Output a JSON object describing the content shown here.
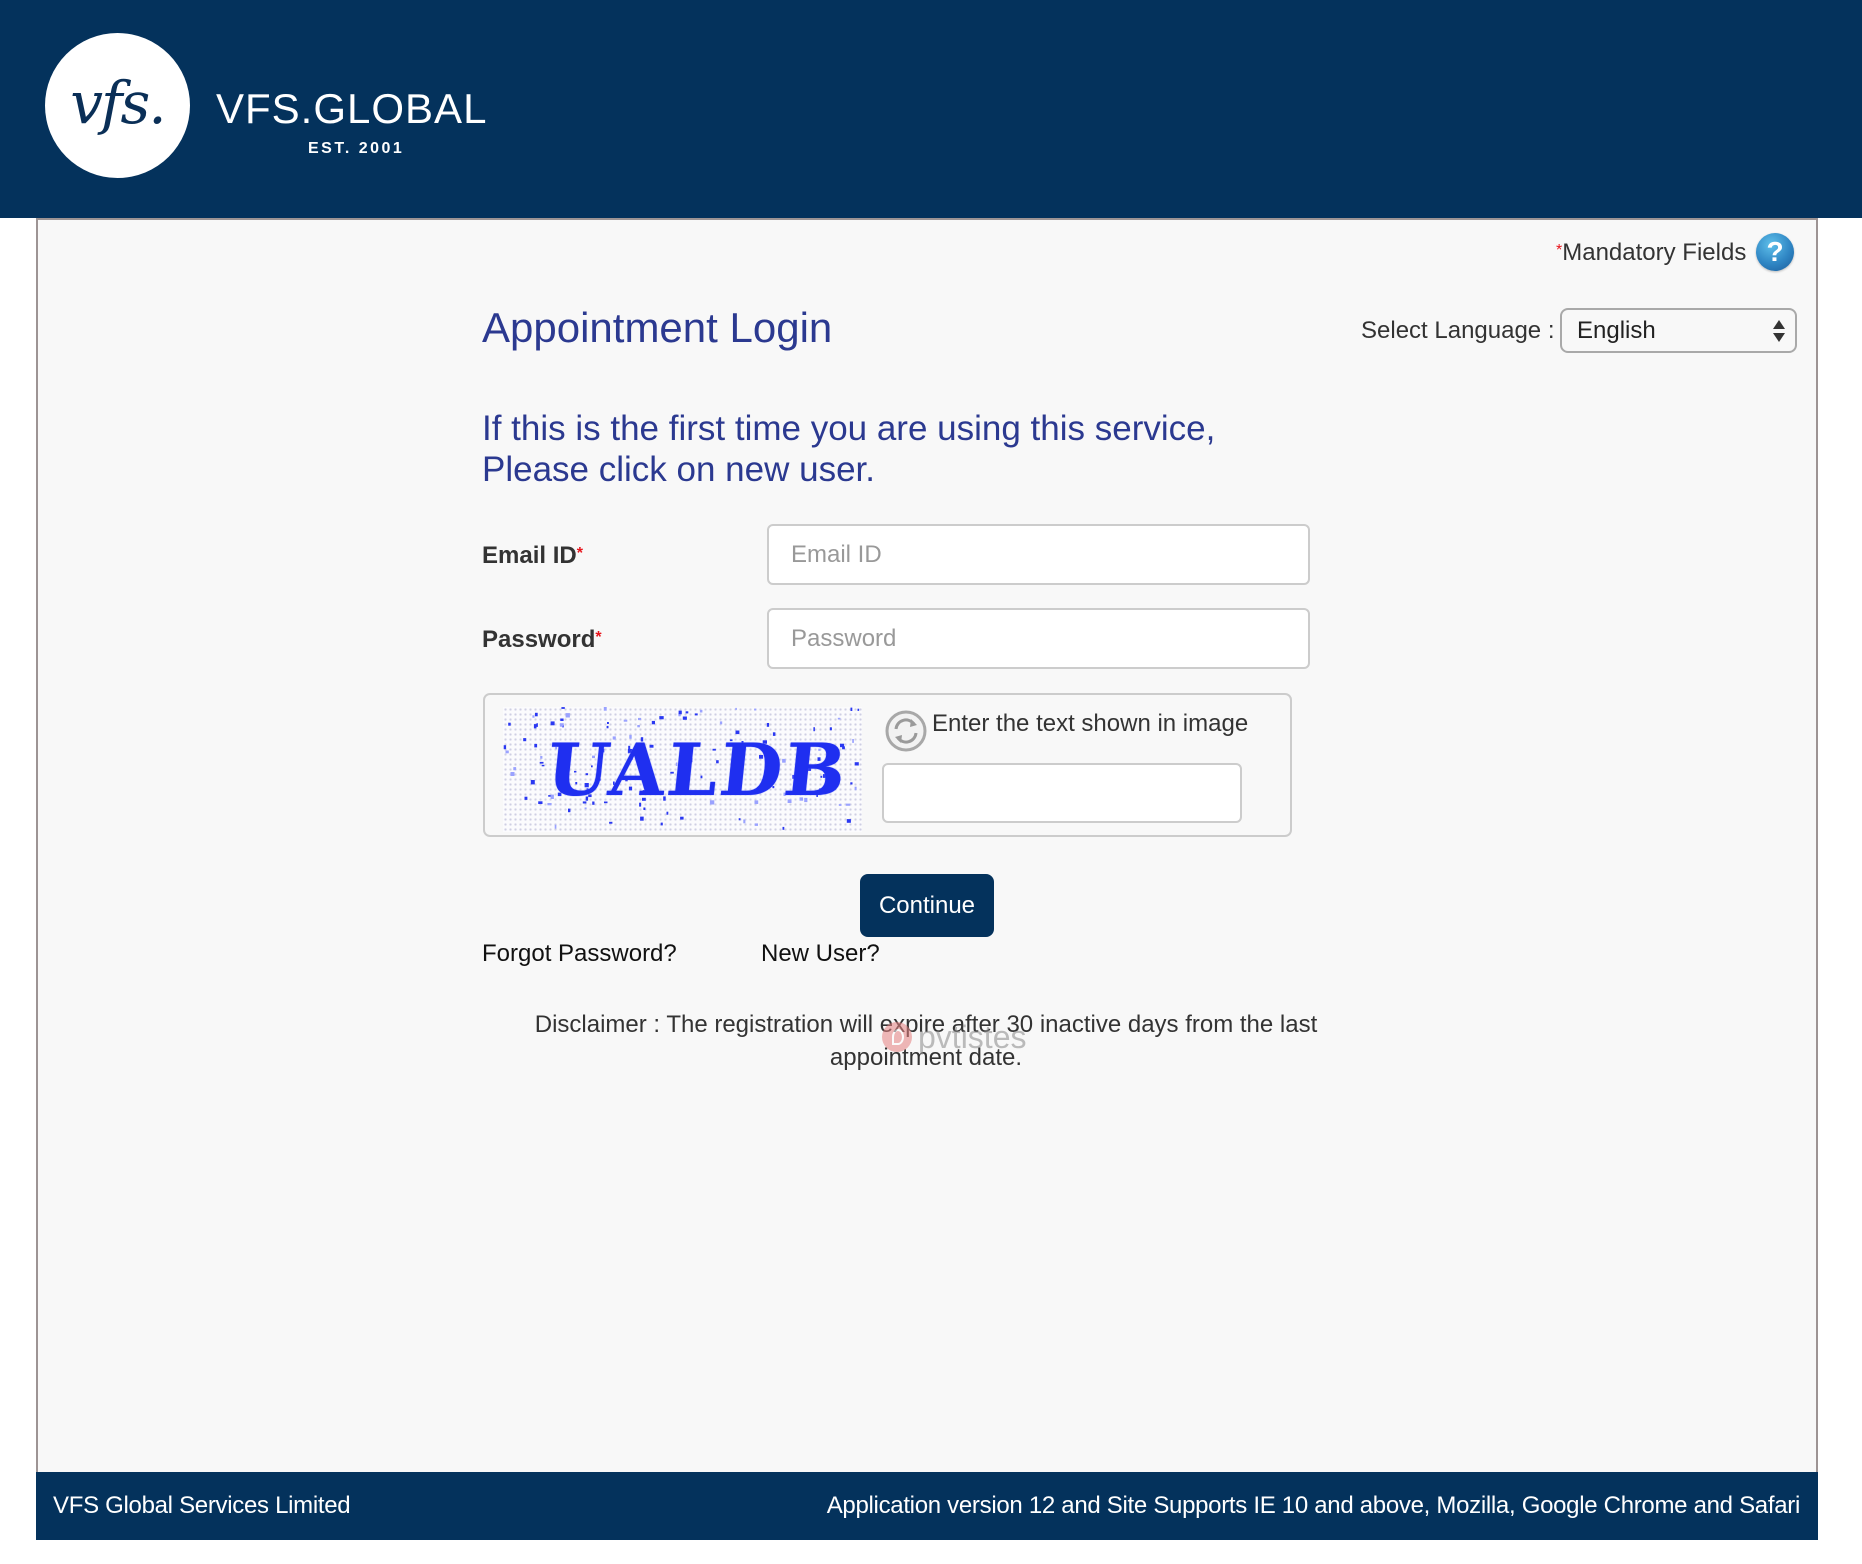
{
  "header": {
    "logo_mark": "vfs.",
    "brand_name": "VFS.GLOBAL",
    "established": "EST. 2001",
    "background_color": "#04325c"
  },
  "mandatory": {
    "star": "*",
    "label": "Mandatory Fields",
    "help_icon": "question-mark-icon",
    "help_glyph": "?"
  },
  "page": {
    "title": "Appointment Login",
    "intro_line1": "If this is the first time you are using this service,",
    "intro_line2": "Please click on new user.",
    "title_color": "#2b3990"
  },
  "language": {
    "label": "Select Language :",
    "selected": "English"
  },
  "form": {
    "email": {
      "label": "Email ID",
      "required_marker": "*",
      "value": "",
      "placeholder": "Email ID"
    },
    "password": {
      "label": "Password",
      "required_marker": "*",
      "value": "",
      "placeholder": "Password"
    },
    "captcha": {
      "image_text": "UALDB",
      "refresh_icon": "refresh-icon",
      "hint": "Enter the text shown in image",
      "value": ""
    },
    "continue_label": "Continue",
    "forgot_password_label": "Forgot Password?",
    "new_user_label": "New User?"
  },
  "disclaimer": {
    "line1": "Disclaimer : The registration will expire after 30 inactive days from the last",
    "line2": "appointment date."
  },
  "watermark": {
    "text": "pvtistes"
  },
  "footer": {
    "left": "VFS Global Services Limited",
    "right": "Application version 12 and Site Supports IE 10 and above, Mozilla, Google Chrome and Safari"
  },
  "colors": {
    "brand_navy": "#04325c",
    "required_red": "#e8141c",
    "heading_blue": "#2b3990",
    "captcha_blue": "#1f2ff0"
  }
}
